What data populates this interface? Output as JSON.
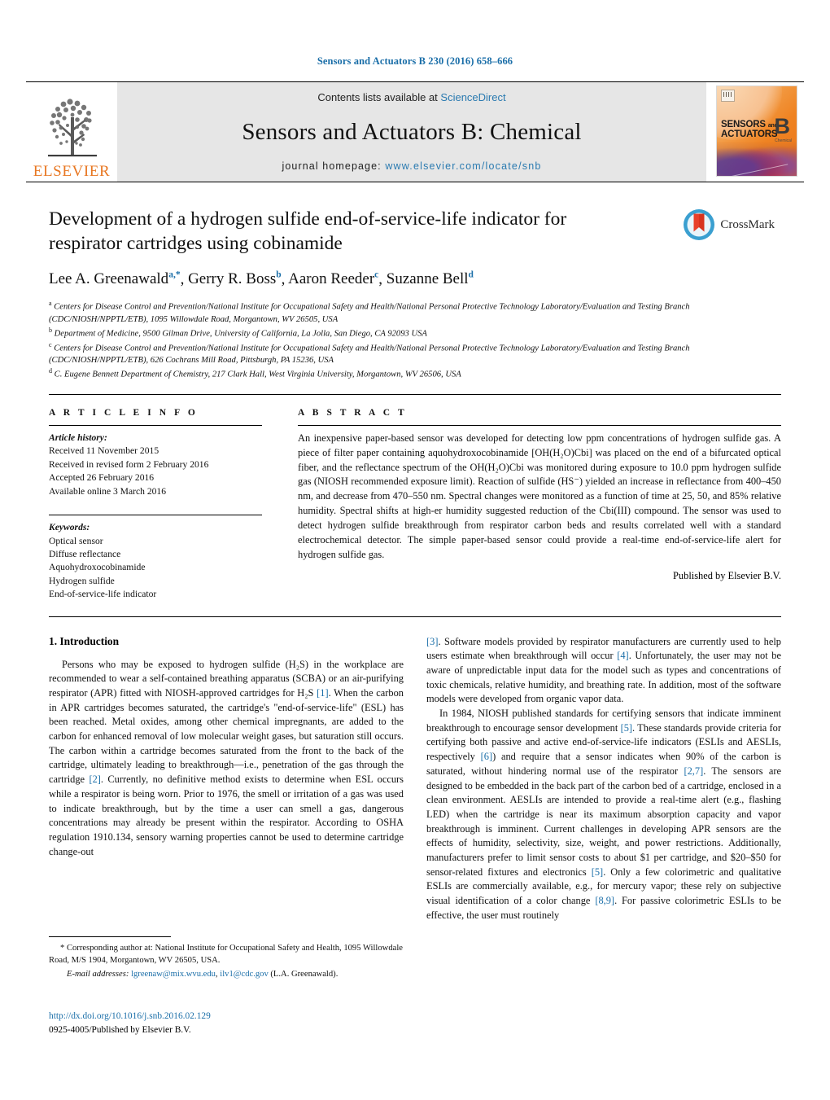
{
  "running_head": "Sensors and Actuators B 230 (2016) 658–666",
  "masthead": {
    "contents_prefix": "Contents lists available at ",
    "sciencedirect": "ScienceDirect",
    "journal_name": "Sensors and Actuators B: Chemical",
    "homepage_label": "journal homepage:",
    "homepage_url": "www.elsevier.com/locate/snb",
    "publisher_wordmark": "ELSEVIER",
    "cover": {
      "line1": "SENSORS",
      "line1_small": "and",
      "line2": "ACTUATORS",
      "letter": "B",
      "letter_sub": "Chemical"
    },
    "accent_orange": "#e87722",
    "link_blue": "#2a7ab0",
    "band_gray": "#e6e6e6"
  },
  "title": "Development of a hydrogen sulfide end-of-service-life indicator for respirator cartridges using cobinamide",
  "crossmark": {
    "label": "CrossMark",
    "ring_color": "#3a9fd0",
    "mark_color": "#e8402a"
  },
  "authors": [
    {
      "name": "Lee A. Greenawald",
      "marks": "a,*"
    },
    {
      "name": "Gerry R. Boss",
      "marks": "b"
    },
    {
      "name": "Aaron Reeder",
      "marks": "c"
    },
    {
      "name": "Suzanne Bell",
      "marks": "d"
    }
  ],
  "affiliations": [
    {
      "mark": "a",
      "text": "Centers for Disease Control and Prevention/National Institute for Occupational Safety and Health/National Personal Protective Technology Laboratory/Evaluation and Testing Branch (CDC/NIOSH/NPPTL/ETB), 1095 Willowdale Road, Morgantown, WV 26505, USA"
    },
    {
      "mark": "b",
      "text": "Department of Medicine, 9500 Gilman Drive, University of California, La Jolla, San Diego, CA 92093 USA"
    },
    {
      "mark": "c",
      "text": "Centers for Disease Control and Prevention/National Institute for Occupational Safety and Health/National Personal Protective Technology Laboratory/Evaluation and Testing Branch (CDC/NIOSH/NPPTL/ETB), 626 Cochrans Mill Road, Pittsburgh, PA 15236, USA"
    },
    {
      "mark": "d",
      "text": "C. Eugene Bennett Department of Chemistry, 217 Clark Hall, West Virginia University, Morgantown, WV 26506, USA"
    }
  ],
  "article_info": {
    "heading": "A R T I C L E   I N F O",
    "history_label": "Article history:",
    "history": [
      "Received 11 November 2015",
      "Received in revised form 2 February 2016",
      "Accepted 26 February 2016",
      "Available online 3 March 2016"
    ],
    "keywords_label": "Keywords:",
    "keywords": [
      "Optical sensor",
      "Diffuse reflectance",
      "Aquohydroxocobinamide",
      "Hydrogen sulfide",
      "End-of-service-life indicator"
    ]
  },
  "abstract": {
    "heading": "A B S T R A C T",
    "text": "An inexpensive paper-based sensor was developed for detecting low ppm concentrations of hydrogen sulfide gas. A piece of filter paper containing aquohydroxocobinamide [OH(H₂O)Cbi] was placed on the end of a bifurcated optical fiber, and the reflectance spectrum of the OH(H₂O)Cbi was monitored during exposure to 10.0 ppm hydrogen sulfide gas (NIOSH recommended exposure limit). Reaction of sulfide (HS⁻) yielded an increase in reflectance from 400–450 nm, and decrease from 470–550 nm. Spectral changes were monitored as a function of time at 25, 50, and 85% relative humidity. Spectral shifts at high-er humidity suggested reduction of the Cbi(III) compound. The sensor was used to detect hydrogen sulfide breakthrough from respirator carbon beds and results correlated well with a standard electrochemical detector. The simple paper-based sensor could provide a real-time end-of-service-life alert for hydrogen sulfide gas.",
    "published_by": "Published by Elsevier B.V."
  },
  "introduction": {
    "heading": "1.  Introduction",
    "left_paragraphs": [
      "Persons who may be exposed to hydrogen sulfide (H₂S) in the workplace are recommended to wear a self-contained breathing apparatus (SCBA) or an air-purifying respirator (APR) fitted with NIOSH-approved cartridges for H₂S [1]. When the carbon in APR cartridges becomes saturated, the cartridge's \"end-of-service-life\" (ESL) has been reached. Metal oxides, among other chemical impregnants, are added to the carbon for enhanced removal of low molecular weight gases, but saturation still occurs. The carbon within a cartridge becomes saturated from the front to the back of the cartridge, ultimately leading to breakthrough—i.e., penetration of the gas through the cartridge [2]. Currently, no definitive method exists to determine when ESL occurs while a respirator is being worn. Prior to 1976, the smell or irritation of a gas was used to indicate breakthrough, but by the time a user can smell a gas, dangerous concentrations may already be present within the respirator. According to OSHA regulation 1910.134, sensory warning properties cannot be used to determine cartridge change-out"
    ],
    "right_paragraphs": [
      "[3]. Software models provided by respirator manufacturers are currently used to help users estimate when breakthrough will occur [4]. Unfortunately, the user may not be aware of unpredictable input data for the model such as types and concentrations of toxic chemicals, relative humidity, and breathing rate. In addition, most of the software models were developed from organic vapor data.",
      "In 1984, NIOSH published standards for certifying sensors that indicate imminent breakthrough to encourage sensor development [5]. These standards provide criteria for certifying both passive and active end-of-service-life indicators (ESLIs and AESLIs, respectively [6]) and require that a sensor indicates when 90% of the carbon is saturated, without hindering normal use of the respirator [2,7]. The sensors are designed to be embedded in the back part of the carbon bed of a cartridge, enclosed in a clean environment. AESLIs are intended to provide a real-time alert (e.g., flashing LED) when the cartridge is near its maximum absorption capacity and vapor breakthrough is imminent. Current challenges in developing APR sensors are the effects of humidity, selectivity, size, weight, and power restrictions. Additionally, manufacturers prefer to limit sensor costs to about $1 per cartridge, and $20–$50 for sensor-related fixtures and electronics [5]. Only a few colorimetric and qualitative ESLIs are commercially available, e.g., for mercury vapor; these rely on subjective visual identification of a color change [8,9]. For passive colorimetric ESLIs to be effective, the user must routinely"
    ]
  },
  "footnotes": {
    "corresponding": "* Corresponding author at: National Institute for Occupational Safety and Health, 1095 Willowdale Road, M/S 1904, Morgantown, WV 26505, USA.",
    "email_label": "E-mail addresses:",
    "email_1": "lgreenaw@mix.wvu.edu",
    "email_2": "ilv1@cdc.gov",
    "email_attrib": "(L.A. Greenawald)."
  },
  "doi_block": {
    "doi": "http://dx.doi.org/10.1016/j.snb.2016.02.129",
    "issn_line": "0925-4005/Published by Elsevier B.V."
  }
}
